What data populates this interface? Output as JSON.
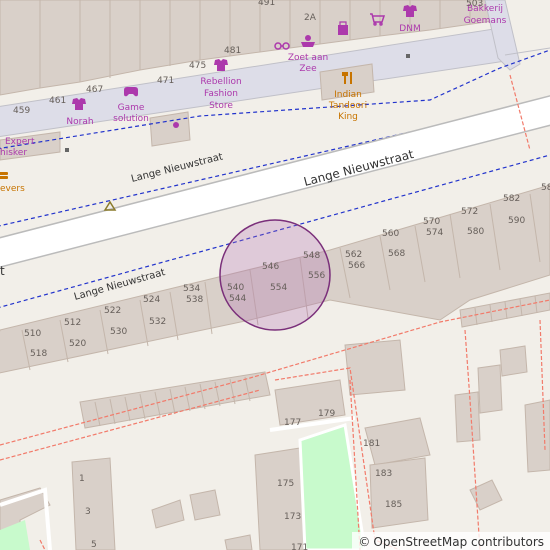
{
  "map": {
    "streets": {
      "main": "Lange Nieuwstraat",
      "parallel": "Lange Nieuwstraat",
      "lower": "Lange Nieuwstraat",
      "edge_fragment": "t"
    },
    "pois": {
      "norah": "Norah",
      "game_solution": [
        "Game",
        "solution"
      ],
      "rebellion": [
        "Rebellion",
        "Fashion",
        "Store"
      ],
      "zoet": [
        "Zoet aan",
        "Zee"
      ],
      "indian": [
        "Indian",
        "Tandoori",
        "King"
      ],
      "dnm": "DNM",
      "bakkerij": [
        "Bakkerij",
        "Goemans"
      ],
      "expert": [
        "Expert",
        "hisker"
      ],
      "evers": "evers"
    },
    "house_numbers": {
      "n491": "491",
      "n2a": "2A",
      "n503": "503",
      "n481": "481",
      "n475": "475",
      "n471": "471",
      "n467": "467",
      "n461": "461",
      "n459": "459",
      "n546": "546",
      "n548": "548",
      "n556": "556",
      "n554": "554",
      "n540": "540",
      "n544": "544",
      "n534": "534",
      "n538": "538",
      "n524": "524",
      "n522": "522",
      "n530": "530",
      "n532": "532",
      "n512": "512",
      "n510": "510",
      "n518": "518",
      "n520": "520",
      "n562": "562",
      "n566": "566",
      "n560": "560",
      "n568": "568",
      "n570": "570",
      "n574": "574",
      "n572": "572",
      "n580": "580",
      "n582": "582",
      "n590": "590",
      "n58x": "58",
      "n177": "177",
      "n179": "179",
      "n181": "181",
      "n183": "183",
      "n185": "185",
      "n175": "175",
      "n173": "173",
      "n171": "171",
      "n1": "1",
      "n3": "3",
      "n5": "5"
    },
    "icons": [
      "recycling-icon",
      "shirt-icon",
      "gamepad-icon",
      "eyeglasses-icon",
      "confectionery-icon",
      "fork-knife-icon",
      "shopping-bag-icon",
      "shopping-cart-icon",
      "waste-basket-icon",
      "fast-food-icon"
    ],
    "colors": {
      "background": "#f2efe9",
      "building": "#d9d0c9",
      "building_stroke": "#c4b6ab",
      "road_fill": "#ffffff",
      "road_casing": "#bbbbbb",
      "bus_route": "#2233cc",
      "boundary": "#f27a6a",
      "park": "#c8facc",
      "poi_purple": "#ac39ac",
      "poi_orange": "#c77400",
      "highlight_fill": "#b06cb0",
      "highlight_stroke": "#7a2f7a"
    }
  },
  "attribution": {
    "symbol": "©",
    "text": "OpenStreetMap contributors"
  }
}
